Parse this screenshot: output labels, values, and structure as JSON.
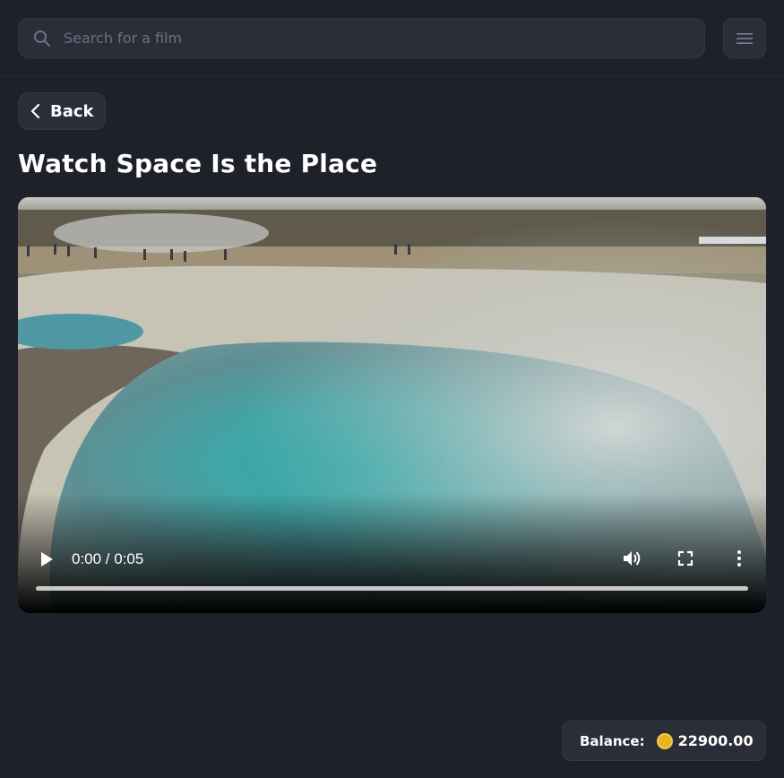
{
  "search": {
    "placeholder": "Search for a film",
    "icon": "search-icon"
  },
  "header": {
    "menu_icon": "menu-icon"
  },
  "nav": {
    "back_label": "Back"
  },
  "page": {
    "title": "Watch Space Is the Place"
  },
  "player": {
    "time_display": "0:00 / 0:05",
    "progress": 0,
    "controls": [
      "play-icon",
      "volume-icon",
      "fullscreen-icon",
      "more-options-icon"
    ]
  },
  "balance": {
    "label": "Balance:",
    "amount": "22900.00",
    "coin_color": "#e8b424"
  }
}
